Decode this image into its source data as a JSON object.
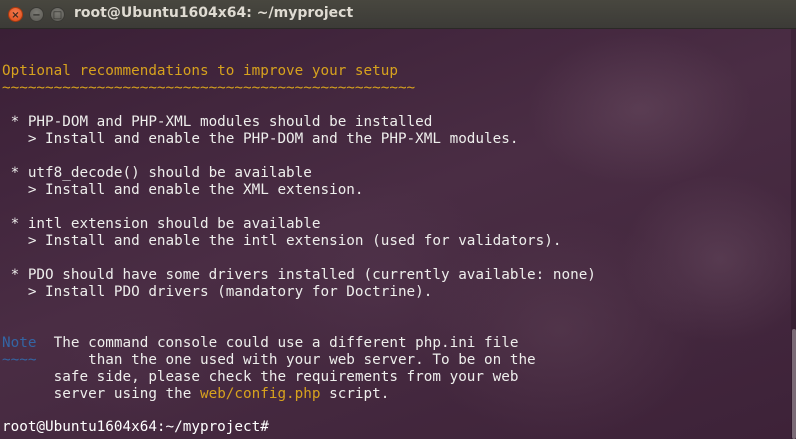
{
  "window": {
    "title": "root@Ubuntu1604x64: ~/myproject",
    "close_glyph": "×",
    "minimize_glyph": "−",
    "maximize_glyph": "□"
  },
  "terminal": {
    "heading": "Optional recommendations to improve your setup",
    "heading_underline": "~~~~~~~~~~~~~~~~~~~~~~~~~~~~~~~~~~~~~~~~~~~~~~~~",
    "items": [
      {
        "text": " * PHP-DOM and PHP-XML modules should be installed",
        "hint": "   > Install and enable the PHP-DOM and the PHP-XML modules."
      },
      {
        "text": " * utf8_decode() should be available",
        "hint": "   > Install and enable the XML extension."
      },
      {
        "text": " * intl extension should be available",
        "hint": "   > Install and enable the intl extension (used for validators)."
      },
      {
        "text": " * PDO should have some drivers installed (currently available: none)",
        "hint": "   > Install PDO drivers (mandatory for Doctrine)."
      }
    ],
    "note": {
      "label": "Note",
      "underline": "~~~~",
      "line1": "  The command console could use a different php.ini file",
      "line2": "      than the one used with your web server. To be on the",
      "line3": "      safe side, please check the requirements from your web",
      "line4_pre": "      server using the ",
      "line4_link": "web/config.php",
      "line4_post": " script."
    },
    "prompt": "root@Ubuntu1604x64:~/myproject#",
    "colors": {
      "heading": "#d7a21e",
      "note": "#3465a4",
      "text": "#eeeeec",
      "background": "#3b2137"
    }
  }
}
